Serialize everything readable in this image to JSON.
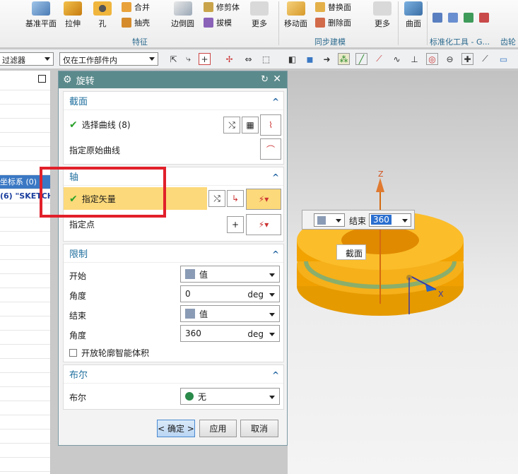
{
  "ribbon": {
    "buttons": [
      "基准平面",
      "拉伸",
      "孔",
      "边倒圆",
      "更多",
      "移动面",
      "更多",
      "曲面"
    ],
    "small_items": [
      "合并",
      "抽壳",
      "修剪体",
      "拔模",
      "替换面",
      "删除面"
    ],
    "groups": [
      "特征",
      "同步建模",
      "标准化工具 - G...",
      "齿轮"
    ]
  },
  "toolbar": {
    "filter_combo": "过滤器",
    "scope_combo": "仅在工作部件内"
  },
  "navigator": {
    "rows": [
      "",
      "",
      "",
      "",
      "",
      "",
      "坐标系 (0)",
      "(6) \"SKETCH_",
      "",
      "",
      "",
      "",
      "",
      "",
      "",
      "",
      "",
      "",
      "",
      "",
      "",
      "",
      "",
      "",
      "",
      "",
      "",
      ""
    ],
    "selected_row_index": 6
  },
  "dialog": {
    "title": "旋转",
    "section_profile": {
      "header": "截面",
      "select_curve": "选择曲线 (8)",
      "specify_origin_curve": "指定原始曲线"
    },
    "section_axis": {
      "header": "轴",
      "specify_vector": "指定矢量",
      "specify_point": "指定点"
    },
    "section_limits": {
      "header": "限制",
      "start_label": "开始",
      "start_value": "值",
      "angle1_label": "角度",
      "angle1_value": "0",
      "angle1_unit": "deg",
      "end_label": "结束",
      "end_value": "值",
      "angle2_label": "角度",
      "angle2_value": "360",
      "angle2_unit": "deg",
      "open_profile_checkbox": "开放轮廓智能体积"
    },
    "section_boolean": {
      "header": "布尔",
      "boolean_label": "布尔",
      "boolean_value": "无"
    },
    "buttons": {
      "ok": "< 确定 >",
      "apply": "应用",
      "cancel": "取消"
    }
  },
  "viewport": {
    "floating_label": "结束",
    "floating_value": "360",
    "section_tag": "截面",
    "axis_z": "Z",
    "axis_x": "X"
  },
  "colors": {
    "part_orange": "#f0a000",
    "dialog_title": "#5b8a8c",
    "highlight_red": "#e1202a",
    "selected_row": "#3a78c4"
  }
}
